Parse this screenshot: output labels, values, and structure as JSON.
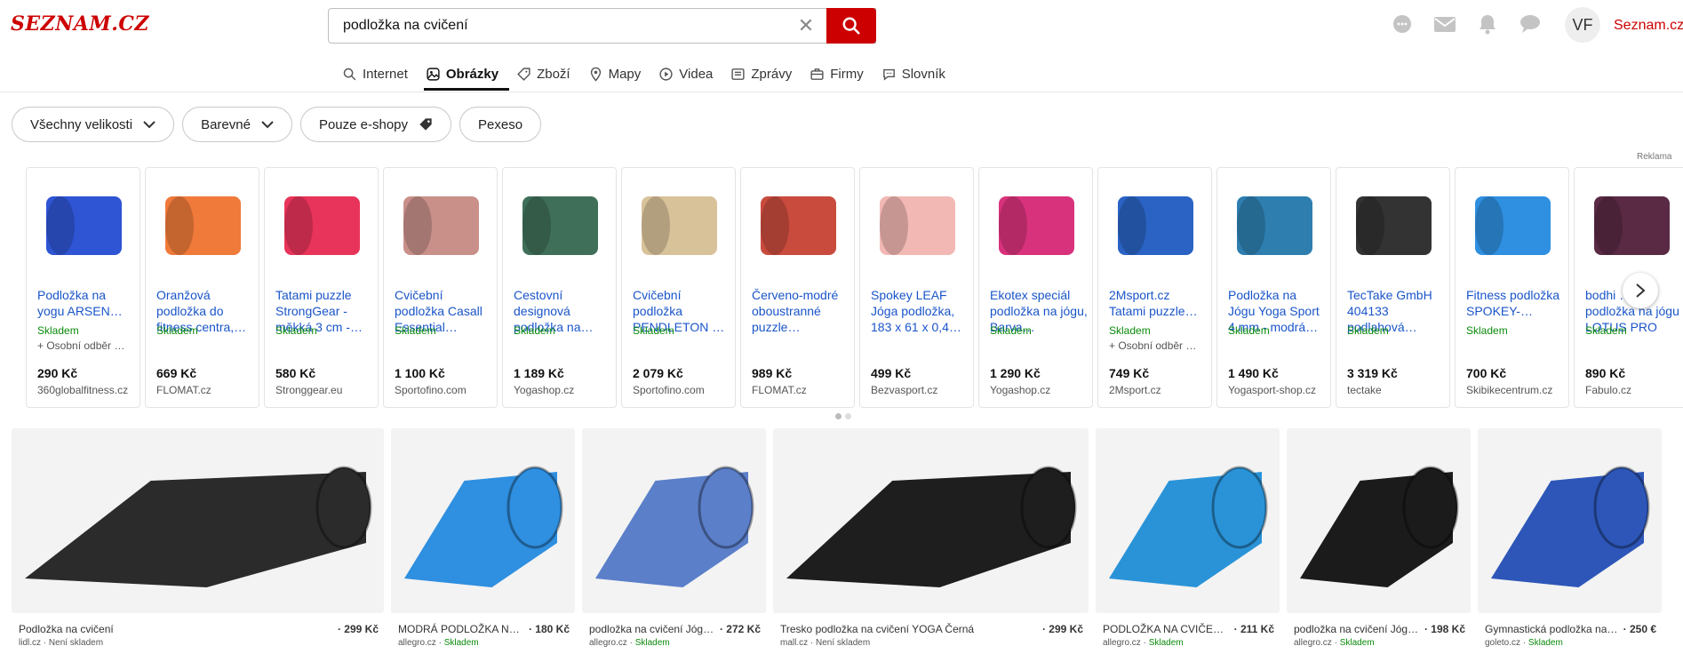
{
  "brand": {
    "logo_text": "SEZNAM.CZ",
    "link": "Seznam.cz",
    "accent": "#cc0000"
  },
  "search": {
    "query": "podložka na cvičení"
  },
  "user": {
    "initials": "VF"
  },
  "tabs": [
    {
      "label": "Internet",
      "icon": "search-icon"
    },
    {
      "label": "Obrázky",
      "icon": "image-icon",
      "active": true
    },
    {
      "label": "Zboží",
      "icon": "tag-icon"
    },
    {
      "label": "Mapy",
      "icon": "map-pin-icon"
    },
    {
      "label": "Videa",
      "icon": "play-icon"
    },
    {
      "label": "Zprávy",
      "icon": "news-icon"
    },
    {
      "label": "Firmy",
      "icon": "briefcase-icon"
    },
    {
      "label": "Slovník",
      "icon": "chat-icon"
    }
  ],
  "filters": [
    {
      "label": "Všechny velikosti",
      "icon": "chevron-down-icon"
    },
    {
      "label": "Barevné",
      "icon": "chevron-down-icon"
    },
    {
      "label": "Pouze e-shopy",
      "icon": "tag-icon"
    },
    {
      "label": "Pexeso",
      "icon": ""
    }
  ],
  "ad_label": "Reklama",
  "products": [
    {
      "title": "Podložka na yogu ARSEN…",
      "stock": "Skladem",
      "extra": "+ Osobní odběr …",
      "price": "290 Kč",
      "shop": "360globalfitness.cz",
      "color": "#2f55d4"
    },
    {
      "title": "Oranžová podložka do fitness centra,…",
      "stock": "Skladem",
      "extra": "",
      "price": "669 Kč",
      "shop": "FLOMAT.cz",
      "color": "#f07a3a"
    },
    {
      "title": "Tatami puzzle StrongGear - měkká 3 cm -…",
      "stock": "Skladem",
      "extra": "",
      "price": "580 Kč",
      "shop": "Stronggear.eu",
      "color": "#e8345a"
    },
    {
      "title": "Cvičební podložka Casall Essential…",
      "stock": "Skladem",
      "extra": "",
      "price": "1 100 Kč",
      "shop": "Sportofino.com",
      "color": "#c9908a"
    },
    {
      "title": "Cestovní designová podložka na…",
      "stock": "Skladem",
      "extra": "",
      "price": "1 189 Kč",
      "shop": "Yogashop.cz",
      "color": "#3f6f58"
    },
    {
      "title": "Cvičební podložka PENDLETON …",
      "stock": "Skladem",
      "extra": "",
      "price": "2 079 Kč",
      "shop": "Sportofino.com",
      "color": "#d8c29a"
    },
    {
      "title": "Červeno-modré oboustranné puzzle…",
      "stock": "",
      "extra": "",
      "price": "989 Kč",
      "shop": "FLOMAT.cz",
      "color": "#c94b3e"
    },
    {
      "title": "Spokey LEAF Jóga podložka, 183 x 61 x 0,4…",
      "stock": "",
      "extra": "",
      "price": "499 Kč",
      "shop": "Bezvasport.cz",
      "color": "#f2b8b4"
    },
    {
      "title": "Ekotex speciál podložka na jógu, Barva…",
      "stock": "Skladem",
      "extra": "",
      "price": "1 290 Kč",
      "shop": "Yogashop.cz",
      "color": "#d9327d"
    },
    {
      "title": "2Msport.cz Tatami puzzle…",
      "stock": "Skladem",
      "extra": "+ Osobní odběr …",
      "price": "749 Kč",
      "shop": "2Msport.cz",
      "color": "#2a63c4"
    },
    {
      "title": "Podložka na Jógu Yoga Sport 4 mm - modrá…",
      "stock": "Skladem",
      "extra": "",
      "price": "1 490 Kč",
      "shop": "Yogasport-shop.cz",
      "color": "#2e7fb0"
    },
    {
      "title": "TecTake GmbH 404133 podlahová…",
      "stock": "Skladem",
      "extra": "",
      "price": "3 319 Kč",
      "shop": "tectake",
      "color": "#333333"
    },
    {
      "title": "Fitness podložka SPOKEY-…",
      "stock": "Skladem",
      "extra": "",
      "price": "700 Kč",
      "shop": "Skibikecentrum.cz",
      "color": "#2f8fe0"
    },
    {
      "title": "bodhi … podložka na jógu LOTUS PRO II.…",
      "stock": "Skladem",
      "extra": "",
      "price": "890 Kč",
      "shop": "Fabulo.cz",
      "color": "#5a2a45"
    }
  ],
  "results": [
    {
      "title": "Podložka na cvičení",
      "price": "· 299 Kč",
      "domain": "lidl.cz",
      "status": "Není skladem",
      "in_stock": false,
      "color": "#2b2b2b"
    },
    {
      "title": "MODRÁ PODLOŽKA N…",
      "price": "· 180 Kč",
      "domain": "allegro.cz",
      "status": "Skladem",
      "in_stock": true,
      "color": "#2f8fe0"
    },
    {
      "title": "podložka na cvičení Jóg…",
      "price": "· 272 Kč",
      "domain": "allegro.cz",
      "status": "Skladem",
      "in_stock": true,
      "color": "#5b7fc9"
    },
    {
      "title": "Tresko podložka na cvičení YOGA Černá",
      "price": "· 299 Kč",
      "domain": "mall.cz",
      "status": "Není skladem",
      "in_stock": false,
      "color": "#1e1e1e"
    },
    {
      "title": "PODLOŽKA NA CVIČE…",
      "price": "· 211 Kč",
      "domain": "allegro.cz",
      "status": "Skladem",
      "in_stock": true,
      "color": "#2a93d8"
    },
    {
      "title": "podložka na cvičení Jóg…",
      "price": "· 198 Kč",
      "domain": "allegro.cz",
      "status": "Skladem",
      "in_stock": true,
      "color": "#1b1b1b"
    },
    {
      "title": "Gymnastická podložka na…",
      "price": "· 250 €",
      "domain": "goleto.cz",
      "status": "Skladem",
      "in_stock": true,
      "color": "#2d56b8"
    }
  ]
}
